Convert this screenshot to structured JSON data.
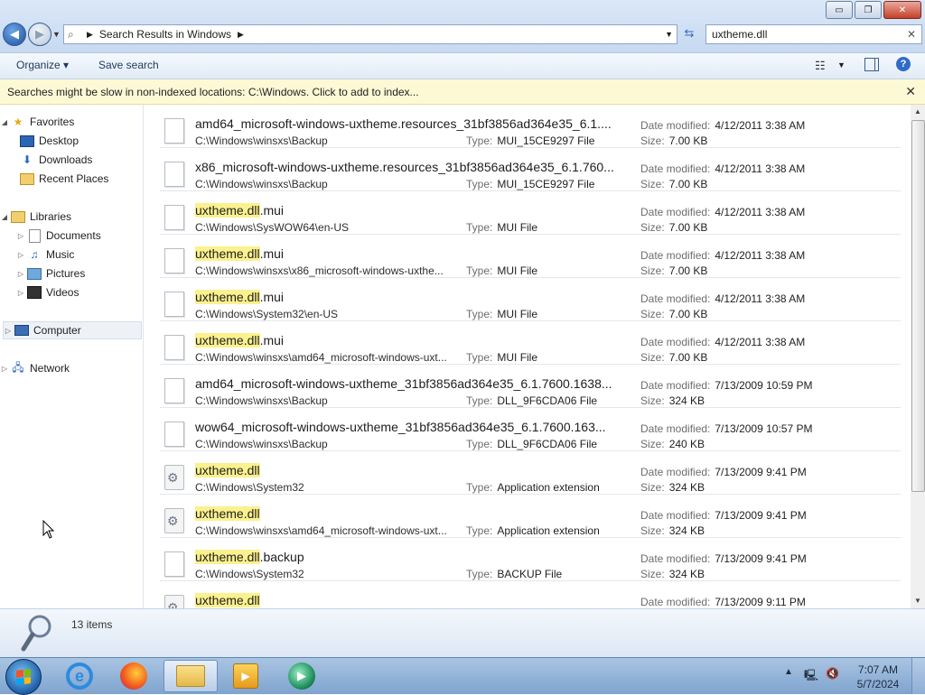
{
  "window": {
    "controls": {
      "minimize": "▭",
      "maximize": "❐",
      "close": "✕"
    }
  },
  "address": {
    "crumb": "Search Results in Windows"
  },
  "search": {
    "value": "uxtheme.dll"
  },
  "toolbar": {
    "organize": "Organize ▾",
    "save_search": "Save search"
  },
  "infobar": {
    "message": "Searches might be slow in non-indexed locations: C:\\Windows. Click to add to index..."
  },
  "nav": {
    "favorites": "Favorites",
    "desktop": "Desktop",
    "downloads": "Downloads",
    "recent": "Recent Places",
    "libraries": "Libraries",
    "documents": "Documents",
    "music": "Music",
    "pictures": "Pictures",
    "videos": "Videos",
    "computer": "Computer",
    "network": "Network"
  },
  "labels": {
    "type": "Type:",
    "date": "Date modified:",
    "size": "Size:"
  },
  "results": [
    {
      "pre": "",
      "hl": "",
      "post": "amd64_microsoft-windows-uxtheme.resources_31bf3856ad364e35_6.1....",
      "path": "C:\\Windows\\winsxs\\Backup",
      "type": "MUI_15CE9297 File",
      "date": "4/12/2011 3:38 AM",
      "size": "7.00 KB",
      "icon": "doc"
    },
    {
      "pre": "",
      "hl": "",
      "post": "x86_microsoft-windows-uxtheme.resources_31bf3856ad364e35_6.1.760...",
      "path": "C:\\Windows\\winsxs\\Backup",
      "type": "MUI_15CE9297 File",
      "date": "4/12/2011 3:38 AM",
      "size": "7.00 KB",
      "icon": "doc"
    },
    {
      "pre": "",
      "hl": "uxtheme.dll",
      "post": ".mui",
      "path": "C:\\Windows\\SysWOW64\\en-US",
      "type": "MUI File",
      "date": "4/12/2011 3:38 AM",
      "size": "7.00 KB",
      "icon": "doc"
    },
    {
      "pre": "",
      "hl": "uxtheme.dll",
      "post": ".mui",
      "path": "C:\\Windows\\winsxs\\x86_microsoft-windows-uxthe...",
      "type": "MUI File",
      "date": "4/12/2011 3:38 AM",
      "size": "7.00 KB",
      "icon": "doc"
    },
    {
      "pre": "",
      "hl": "uxtheme.dll",
      "post": ".mui",
      "path": "C:\\Windows\\System32\\en-US",
      "type": "MUI File",
      "date": "4/12/2011 3:38 AM",
      "size": "7.00 KB",
      "icon": "doc"
    },
    {
      "pre": "",
      "hl": "uxtheme.dll",
      "post": ".mui",
      "path": "C:\\Windows\\winsxs\\amd64_microsoft-windows-uxt...",
      "type": "MUI File",
      "date": "4/12/2011 3:38 AM",
      "size": "7.00 KB",
      "icon": "doc"
    },
    {
      "pre": "",
      "hl": "",
      "post": "amd64_microsoft-windows-uxtheme_31bf3856ad364e35_6.1.7600.1638...",
      "path": "C:\\Windows\\winsxs\\Backup",
      "type": "DLL_9F6CDA06 File",
      "date": "7/13/2009 10:59 PM",
      "size": "324 KB",
      "icon": "doc"
    },
    {
      "pre": "",
      "hl": "",
      "post": "wow64_microsoft-windows-uxtheme_31bf3856ad364e35_6.1.7600.163...",
      "path": "C:\\Windows\\winsxs\\Backup",
      "type": "DLL_9F6CDA06 File",
      "date": "7/13/2009 10:57 PM",
      "size": "240 KB",
      "icon": "doc"
    },
    {
      "pre": "",
      "hl": "uxtheme.dll",
      "post": "",
      "path": "C:\\Windows\\System32",
      "type": "Application extension",
      "date": "7/13/2009 9:41 PM",
      "size": "324 KB",
      "icon": "ext"
    },
    {
      "pre": "",
      "hl": "uxtheme.dll",
      "post": "",
      "path": "C:\\Windows\\winsxs\\amd64_microsoft-windows-uxt...",
      "type": "Application extension",
      "date": "7/13/2009 9:41 PM",
      "size": "324 KB",
      "icon": "ext"
    },
    {
      "pre": "",
      "hl": "uxtheme.dll",
      "post": ".backup",
      "path": "C:\\Windows\\System32",
      "type": "BACKUP File",
      "date": "7/13/2009 9:41 PM",
      "size": "324 KB",
      "icon": "doc"
    },
    {
      "pre": "",
      "hl": "uxtheme.dll",
      "post": "",
      "path": "",
      "type": "",
      "date": "7/13/2009 9:11 PM",
      "size": "",
      "icon": "ext"
    }
  ],
  "details": {
    "count": "13 items"
  },
  "taskbar": {
    "time": "7:07 AM",
    "date": "5/7/2024"
  }
}
